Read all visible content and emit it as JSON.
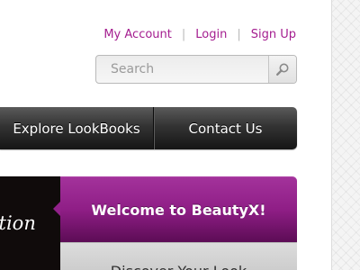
{
  "header": {
    "links": [
      {
        "label": "My Account"
      },
      {
        "label": "Login"
      },
      {
        "label": "Sign Up"
      }
    ],
    "separator": "|"
  },
  "search": {
    "placeholder": "Search",
    "value": "",
    "icon": "search-icon"
  },
  "nav": {
    "items": [
      {
        "label": "Explore LookBooks"
      },
      {
        "label": "Contact Us"
      }
    ]
  },
  "hero": {
    "caption_fragment": "ation",
    "welcome_label": "Welcome to BeautyX!",
    "next_label_fragment": "Discover Your Look"
  },
  "colors": {
    "accent": "#a41d8f",
    "welcome_bg": "#8f1e86",
    "nav_bg": "#2a2a2a"
  }
}
